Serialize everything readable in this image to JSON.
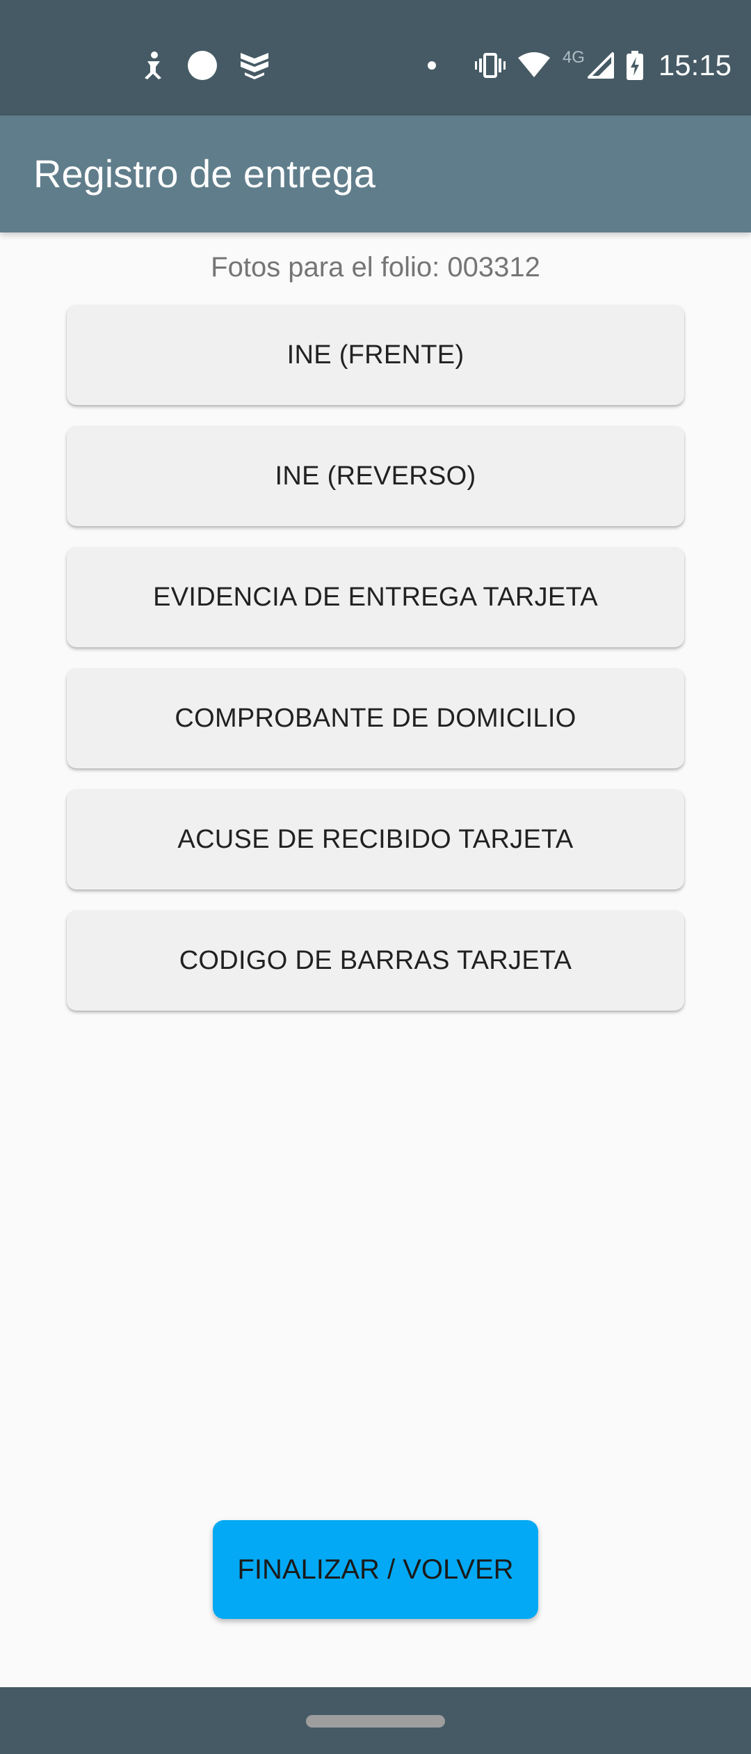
{
  "status_bar": {
    "left_icons": [
      "accessibility-icon",
      "circle-icon",
      "shield-icon"
    ],
    "right_icons": [
      "dot-icon",
      "vibrate-icon",
      "wifi-icon",
      "cell-signal-icon",
      "battery-charging-icon"
    ],
    "network_type": "4G",
    "time": "15:15"
  },
  "app_bar": {
    "title": "Registro de entrega"
  },
  "folio": {
    "label": "Fotos para el folio: ",
    "number": "003312"
  },
  "photo_buttons": [
    {
      "label": "INE (FRENTE)"
    },
    {
      "label": "INE (REVERSO)"
    },
    {
      "label": "EVIDENCIA DE ENTREGA TARJETA"
    },
    {
      "label": "COMPROBANTE DE DOMICILIO"
    },
    {
      "label": "ACUSE DE RECIBIDO TARJETA"
    },
    {
      "label": "CODIGO DE BARRAS TARJETA"
    }
  ],
  "finish_button": {
    "label": "FINALIZAR / VOLVER"
  },
  "colors": {
    "status_bar": "#455a64",
    "app_bar": "#607d8b",
    "background": "#fafafa",
    "button_bg": "#f0f0f0",
    "accent": "#03a9f4"
  }
}
